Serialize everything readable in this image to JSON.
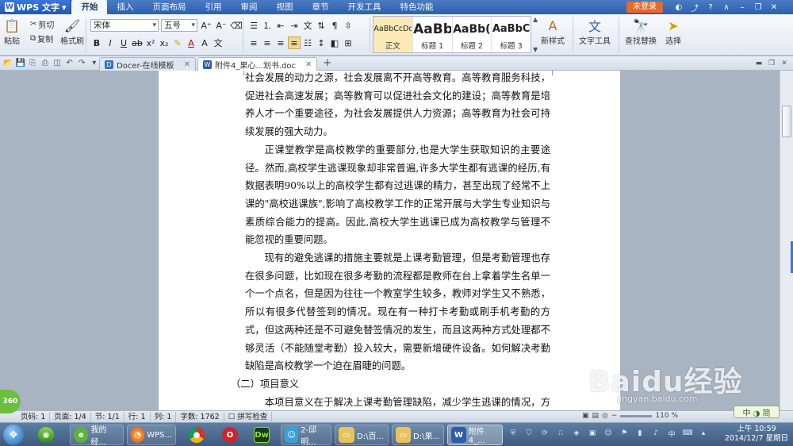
{
  "app": {
    "name": "WPS 文字",
    "login_label": "未登录"
  },
  "menu": [
    "开始",
    "插入",
    "页面布局",
    "引用",
    "审阅",
    "视图",
    "章节",
    "开发工具",
    "特色功能"
  ],
  "ribbon": {
    "paste": "粘贴",
    "cut": "剪切",
    "copy": "复制",
    "format_painter": "格式刷",
    "font_name": "宋体",
    "font_size": "五号",
    "styles": [
      {
        "sample": "AaBbCcDd",
        "name": "正文"
      },
      {
        "sample": "AaBb",
        "name": "标题 1"
      },
      {
        "sample": "AaBb(",
        "name": "标题 2"
      },
      {
        "sample": "AaBbC",
        "name": "标题 3"
      }
    ],
    "new_style": "新样式",
    "text_tools": "文字工具",
    "find_replace": "查找替换",
    "select": "选择"
  },
  "tabs": [
    {
      "label": "Docer-在线模板"
    },
    {
      "label": "附件4_果心...划书.doc"
    }
  ],
  "document": {
    "paragraphs": [
      "社会发展的动力之源，社会发展离不开高等教育。高等教育服务科技，促进社会高速发展；高等教育可以促进社会文化的建设；高等教育是培养人才一个重要途径，为社会发展提供人力资源；高等教育为社会可持续发展的强大动力。",
      "正课堂教学是高校教学的重要部分,也是大学生获取知识的主要途径。然而,高校学生逃课现象却非常普遍,许多大学生都有逃课的经历,有数据表明90%以上的高校学生都有过逃课的精力，甚至出现了经常不上课的\"高校逃课族\",影响了高校教学工作的正常开展与大学生专业知识与素质综合能力的提高。因此,高校大学生逃课已成为高校教学与管理不能忽视的重要问题。",
      "现有的避免逃课的措施主要就是上课考勤管理，但是考勤管理也存在很多问题，比如现在很多考勤的流程都是教师在台上拿着学生名单一个一个点名，但是因为往往一个教室学生较多，教师对学生又不熟悉，所以有很多代替签到的情况。现在有一种打卡考勤或刷手机考勤的方式，但这两种还是不可避免替签情况的发生，而且这两种方式处理都不够灵活（不能随堂考勤）投入较大，需要新增硬件设备。如何解决考勤缺陷是高校教学一个迫在眉睫的问题。",
      "（二）项目意义",
      "本项目意义在于解决上课考勤管理缺陷，减少学生逃课的情况，方便教师和学校进行考勤管理，而且尽量用最低的成本来实现一个完整的考勤管理"
    ]
  },
  "status": {
    "page_num": "页码: 1",
    "pages": "页面: 1/4",
    "section": "节: 1/1",
    "row": "行: 1",
    "col": "列: 1",
    "words": "字数: 1762",
    "spell": "拼写检查",
    "zoom": "110 %"
  },
  "taskbar": {
    "items": [
      {
        "label": "我的经..."
      },
      {
        "label": "WPS..."
      },
      {
        "label": "2-邱明..."
      },
      {
        "label": "D:\\百..."
      },
      {
        "label": "D:\\果..."
      },
      {
        "label": "附件4_..."
      }
    ],
    "ime": "中",
    "clock_time": "上午 10:59",
    "clock_date": "2014/12/7 星期日"
  },
  "overlay": {
    "badge": "360",
    "ime_bar": "中 ◑ 简",
    "watermark_logo": "Baidu经验",
    "watermark_url": "jingyan.baidu.com"
  },
  "colors": {
    "titlebar": "#2f5fa8",
    "login": "#e86a2a",
    "accent": "#3c78d8"
  }
}
